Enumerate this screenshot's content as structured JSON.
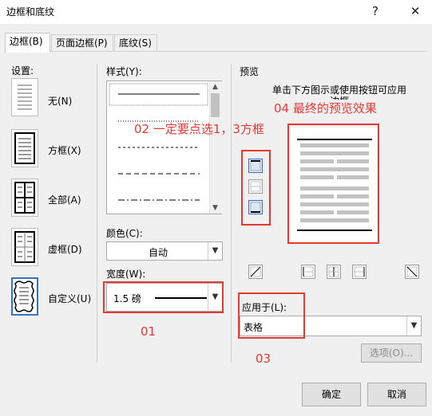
{
  "window": {
    "title": "边框和底纹",
    "help": "?",
    "close": "✕"
  },
  "tabs": [
    {
      "label": "边框(B)",
      "active": true
    },
    {
      "label": "页面边框(P)",
      "active": false
    },
    {
      "label": "底纹(S)",
      "active": false
    }
  ],
  "settings": {
    "heading": "设置:",
    "items": [
      {
        "label": "无(N)"
      },
      {
        "label": "方框(X)"
      },
      {
        "label": "全部(A)"
      },
      {
        "label": "虚框(D)"
      },
      {
        "label": "自定义(U)",
        "selected": true
      }
    ]
  },
  "style": {
    "heading": "样式(Y):",
    "color_label": "颜色(C):",
    "color_value": "自动",
    "width_label": "宽度(W):",
    "width_value": "1.5 磅"
  },
  "preview": {
    "heading": "预览",
    "hint": "单击下方图示或使用按钮可应用边框",
    "apply_label": "应用于(L):",
    "apply_value": "表格",
    "options_button": "选项(O)..."
  },
  "annotations": {
    "a01": "01",
    "a02": "02 一定要点选1，3方框",
    "a03": "03",
    "a04": "04 最终的预览效果",
    "color": "#e53935"
  },
  "footer": {
    "ok": "确定",
    "cancel": "取消"
  }
}
